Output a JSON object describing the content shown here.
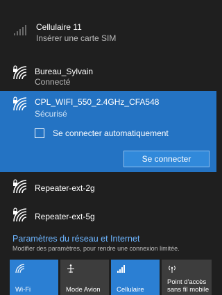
{
  "networks": {
    "cellular": {
      "name": "Cellulaire 11",
      "status": "Insérer une carte SIM"
    },
    "bureau": {
      "name": "Bureau_Sylvain",
      "status": "Connecté"
    },
    "cpl": {
      "name": "CPL_WIFI_550_2.4GHz_CFA548",
      "status": "Sécurisé",
      "auto_connect_label": "Se connecter automatiquement",
      "auto_connect_checked": false,
      "connect_button": "Se connecter"
    },
    "repeater2g": {
      "name": "Repeater-ext-2g"
    },
    "repeater5g": {
      "name": "Repeater-ext-5g"
    }
  },
  "settings": {
    "link": "Paramètres du réseau et Internet",
    "description": "Modifier des paramètres, pour rendre une connexion limitée."
  },
  "quick_actions": [
    {
      "label": "Wi-Fi",
      "icon": "wifi-icon",
      "active": true
    },
    {
      "label": "Mode Avion",
      "icon": "airplane-icon",
      "active": false
    },
    {
      "label": "Cellulaire",
      "icon": "cellular-icon",
      "active": true
    },
    {
      "label_line1": "Point d'accès",
      "label_line2": "sans fil mobile",
      "icon": "hotspot-icon",
      "active": false
    }
  ],
  "colors": {
    "background": "#1f1f1f",
    "selected": "#2473c3",
    "accent_tile": "#2b7fd3",
    "link": "#6db5ff"
  }
}
